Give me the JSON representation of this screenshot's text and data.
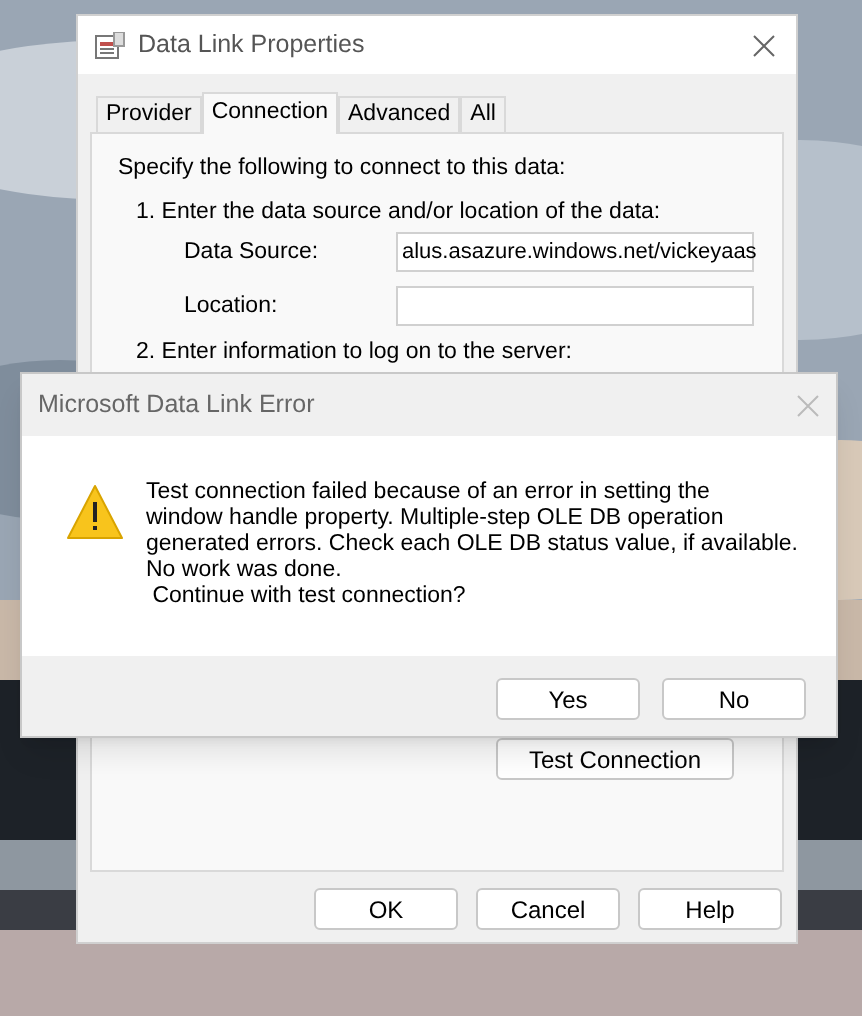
{
  "properties_window": {
    "title": "Data Link Properties",
    "tabs": [
      {
        "label": "Provider",
        "selected": false
      },
      {
        "label": "Connection",
        "selected": true
      },
      {
        "label": "Advanced",
        "selected": false
      },
      {
        "label": "All",
        "selected": false
      }
    ],
    "intro": "Specify the following to connect to this data:",
    "step_1": "1. Enter the data source and/or location of the data:",
    "fields": [
      {
        "label": "Data Source:",
        "value": "alus.asazure.windows.net/vickeyaas"
      },
      {
        "label": "Location:"
      }
    ],
    "step_2": "2. Enter information to log on to the server:",
    "test_button": "Test Connection",
    "buttons": [
      "OK",
      "Cancel",
      "Help"
    ]
  },
  "error_dialog": {
    "title": "Microsoft Data Link Error",
    "message": [
      "Test connection failed because of an error in setting the",
      "window handle property. Multiple-step OLE DB operation",
      "generated errors. Check each OLE DB status value, if available.",
      "No work was done.",
      " Continue with test connection?"
    ],
    "buttons": [
      "Yes",
      "No"
    ]
  }
}
